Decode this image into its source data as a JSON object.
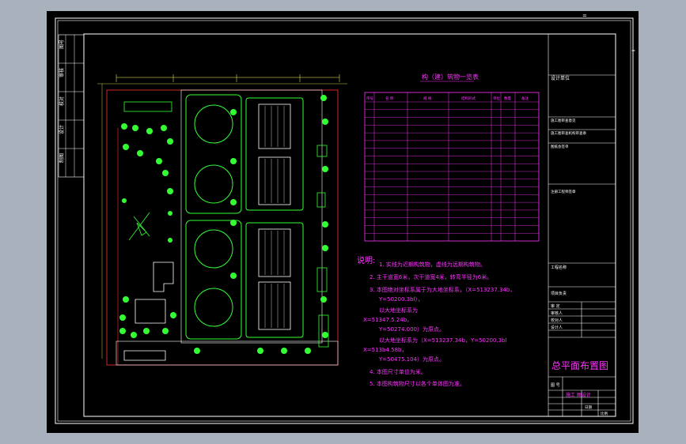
{
  "drawing": {
    "top_right_mark": "=",
    "side_mark": "="
  },
  "left_strip": {
    "labels": [
      "图号",
      "审核",
      "校对",
      "设计",
      "制图"
    ]
  },
  "table": {
    "title": "构（建）筑物一览表",
    "headers": [
      "序号",
      "名 称",
      "规 格",
      "结构形式",
      "单位",
      "数量",
      "备注"
    ],
    "row_count": 18
  },
  "notes": {
    "heading": "说明:",
    "lines": [
      "1. 实线为近期构筑物，虚线为远期构筑物。",
      "2. 主干道宽6米，次干道宽4米，转弯半径为6米。",
      "3. 本图绝对坐标系属于为大地坐标系，（X=513237.34b，",
      "Y=50200.3bl），",
      "以大地坐标系为",
      "X=51347.5.24b，",
      "Y=50274.000）为原点。",
      "以大地坐标系为（X=513237.34b，Y=50200.3bl",
      "X=513b4.58b，",
      "Y=50475.104）为原点。",
      "4. 本图尺寸单位为米。",
      "5. 本图构筑物尺寸以各个单体图为准。"
    ]
  },
  "title_block": {
    "company": "设计单位",
    "rows": [
      "施工图审查意见",
      "施工图审查机构审查章",
      "图纸会签单",
      "注册工程师签章"
    ],
    "project_label": "工程名称",
    "roles": [
      "项目负责",
      "审 定",
      "审核人",
      "校对人",
      "设计人"
    ],
    "drawing_title": "总平面布置图",
    "sheet_label": "图 号",
    "drawing_number": "施工 图设计",
    "date_label": "日期",
    "scale_label": "比例"
  },
  "colors": {
    "background": "#000000",
    "frame": "#ffffff",
    "annotation": "#ff33ff",
    "site": "#33ff33",
    "boundary": "#ff3333",
    "dimension": "#ffff66"
  }
}
